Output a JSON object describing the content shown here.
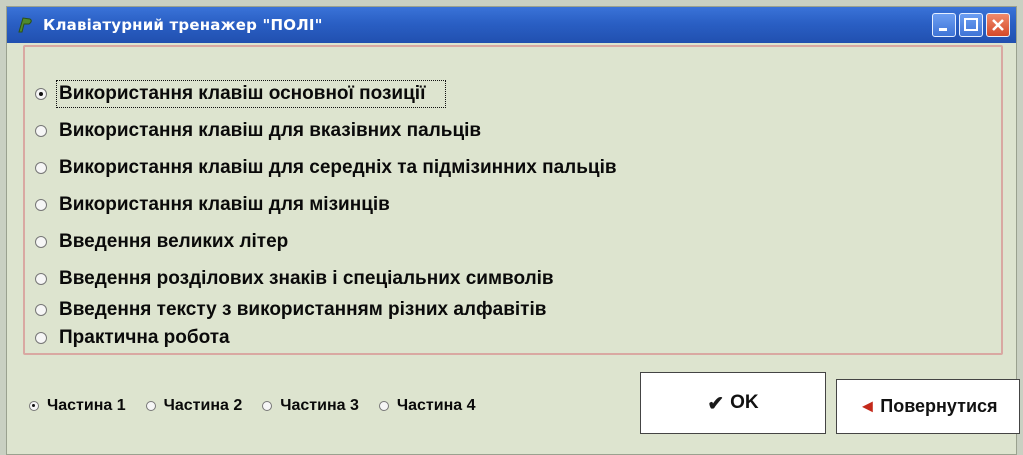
{
  "window": {
    "title": "Клавіатурний тренажер \"ПОЛІ\"",
    "controls": [
      "minimize",
      "maximize",
      "close"
    ]
  },
  "options": [
    {
      "label": "Використання клавіш основної позиції",
      "checked": true
    },
    {
      "label": "Використання клавіш для вказівних пальців",
      "checked": false
    },
    {
      "label": "Використання клавіш для середніх та підмізинних пальців",
      "checked": false
    },
    {
      "label": "Використання клавіш для мізинців",
      "checked": false
    },
    {
      "label": "Введення великих літер",
      "checked": false
    },
    {
      "label": "Введення розділових знаків  і спеціальних символів",
      "checked": false
    },
    {
      "label": "Введення тексту з використанням різних алфавітів",
      "checked": false
    },
    {
      "label": "Практична робота",
      "checked": false
    }
  ],
  "parts": [
    {
      "label": "Частина 1",
      "checked": true
    },
    {
      "label": "Частина 2",
      "checked": false
    },
    {
      "label": "Частина 3",
      "checked": false
    },
    {
      "label": "Частина 4",
      "checked": false
    }
  ],
  "buttons": {
    "ok_label": "OK",
    "back_label": "Повернутися"
  },
  "colors": {
    "titlebar": "#2a5fc4",
    "background": "#dde4cf",
    "group_border": "#d9a8a2",
    "back_arrow": "#c4291a"
  }
}
